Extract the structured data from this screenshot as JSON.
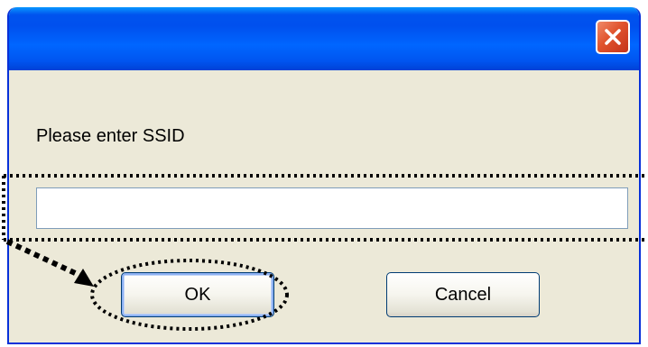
{
  "window": {
    "title": "",
    "close_icon": "close-icon"
  },
  "dialog": {
    "prompt": "Please enter SSID",
    "ssid_value": "",
    "ok_label": "OK",
    "cancel_label": "Cancel"
  },
  "annotations": {
    "style": "dotted",
    "color": "#000000",
    "marks": [
      "input-highlight-box",
      "ok-button-highlight-ellipse",
      "pointer-arrow"
    ]
  },
  "colors": {
    "titlebar": "#0055ea",
    "dialog_background": "#ece9d8",
    "close_button": "#e0532d",
    "input_border": "#7f9db9",
    "button_border": "#003c74"
  }
}
